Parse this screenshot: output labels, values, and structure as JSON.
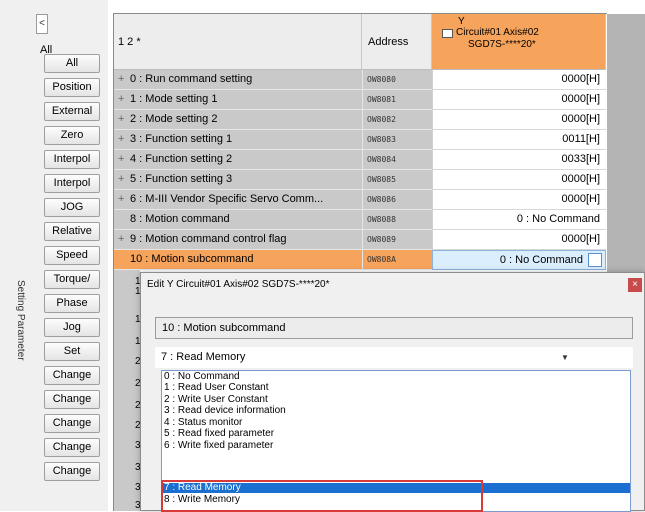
{
  "panel": {
    "vertical_label": "Setting Parameter",
    "collapse": "<",
    "all_label": "All",
    "buttons": [
      "All",
      "Position",
      "External",
      "Zero",
      "Interpol",
      "Interpol",
      "JOG",
      "Relative",
      "Speed",
      "Torque/",
      "Phase",
      "Jog",
      "Set",
      "Change",
      "Change",
      "Change",
      "Change",
      "Change"
    ]
  },
  "grid": {
    "header": {
      "levels": "1 2 *",
      "address": "Address",
      "col_marker": "Y",
      "col_line1": "Circuit#01 Axis#02",
      "col_line2": "SGD7S-****20*"
    },
    "rows": [
      {
        "expand": "+",
        "name": "0 : Run command setting",
        "address": "OW8080",
        "value": "0000[H]"
      },
      {
        "expand": "+",
        "name": "1 : Mode setting 1",
        "address": "OW8081",
        "value": "0000[H]"
      },
      {
        "expand": "+",
        "name": "2 : Mode setting 2",
        "address": "OW8082",
        "value": "0000[H]"
      },
      {
        "expand": "+",
        "name": "3 : Function setting 1",
        "address": "OW8083",
        "value": "0011[H]"
      },
      {
        "expand": "+",
        "name": "4 : Function setting 2",
        "address": "OW8084",
        "value": "0033[H]"
      },
      {
        "expand": "+",
        "name": "5 : Function setting 3",
        "address": "OW8085",
        "value": "0000[H]"
      },
      {
        "expand": "+",
        "name": "6 : M-III Vendor Specific Servo Comm...",
        "address": "OW8086",
        "value": "0000[H]"
      },
      {
        "expand": "",
        "name": "8 : Motion command",
        "address": "OW8088",
        "value": "0 : No Command"
      },
      {
        "expand": "+",
        "name": "9 : Motion command control flag",
        "address": "OW8089",
        "value": "0000[H]"
      },
      {
        "expand": "",
        "name": "10 : Motion subcommand",
        "address": "OW808A",
        "value": "0 : No Command"
      }
    ],
    "partial_rows": [
      "12",
      "14",
      "16",
      "18",
      "20",
      "22",
      "24",
      "28",
      "30",
      "32",
      "34",
      "38"
    ]
  },
  "dialog": {
    "title": "Edit  Y  Circuit#01 Axis#02  SGD7S-****20*",
    "close": "×",
    "param_name": "10 : Motion subcommand",
    "selected_value": "7 : Read Memory",
    "options": [
      "0 : No Command",
      "1 : Read User Constant",
      "2 : Write User Constant",
      "3 : Read device information",
      "4 : Status monitor",
      "5 : Read fixed parameter",
      "6 : Write fixed parameter",
      "7 : Read Memory",
      "8 : Write Memory"
    ]
  },
  "colors": {
    "header_orange": "#f6a35c",
    "selection_blue": "#1a6fd0",
    "highlight_red": "#d83a3a"
  }
}
